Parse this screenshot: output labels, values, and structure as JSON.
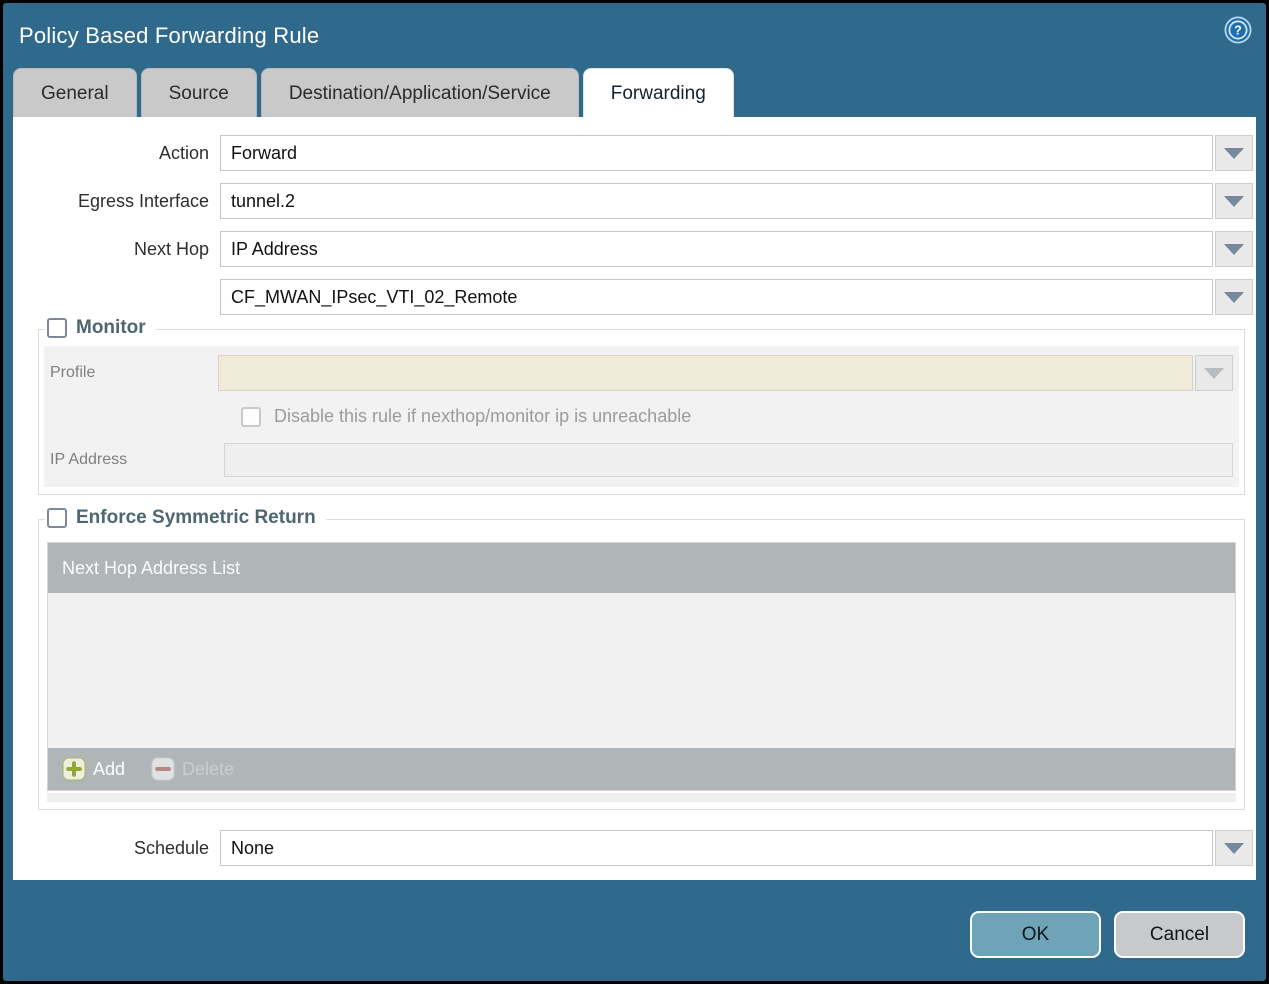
{
  "window": {
    "title": "Policy Based Forwarding Rule",
    "help_icon": "help-question-icon"
  },
  "tabs": [
    {
      "label": "General",
      "active": false
    },
    {
      "label": "Source",
      "active": false
    },
    {
      "label": "Destination/Application/Service",
      "active": false
    },
    {
      "label": "Forwarding",
      "active": true
    }
  ],
  "form": {
    "action_label": "Action",
    "action_value": "Forward",
    "egress_interface_label": "Egress Interface",
    "egress_interface_value": "tunnel.2",
    "next_hop_label": "Next Hop",
    "next_hop_value": "IP Address",
    "next_hop_address_value": "CF_MWAN_IPsec_VTI_02_Remote",
    "schedule_label": "Schedule",
    "schedule_value": "None"
  },
  "monitor_section": {
    "title": "Monitor",
    "checked": false,
    "profile_label": "Profile",
    "profile_value": "",
    "disable_rule_label": "Disable this rule if nexthop/monitor ip is unreachable",
    "disable_rule_checked": false,
    "ip_address_label": "IP Address",
    "ip_address_value": ""
  },
  "symmetric_return_section": {
    "title": "Enforce Symmetric Return",
    "checked": false,
    "list_header": "Next Hop Address List",
    "list_rows": [],
    "add_button_label": "Add",
    "delete_button_label": "Delete",
    "delete_button_enabled": false
  },
  "dialog_buttons": {
    "ok_label": "OK",
    "cancel_label": "Cancel"
  },
  "colors": {
    "background_teal": "#2F6A8C",
    "ok_button": "#6FA3B8",
    "cancel_button": "#C7C9CB",
    "disabled_field_cream": "#F0EBD8",
    "table_header_gray": "#B0B5B8",
    "section_title": "#4D6672",
    "dropdown_arrow": "#76889C",
    "add_icon_green": "#94A637"
  }
}
